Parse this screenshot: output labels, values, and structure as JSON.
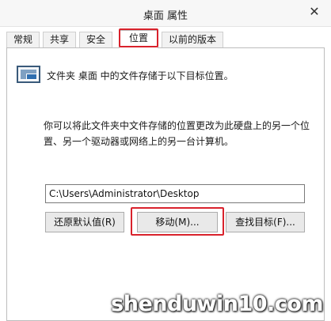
{
  "window": {
    "title": "桌面 属性",
    "close_glyph": "✕"
  },
  "tabs": [
    {
      "label": "常规",
      "active": false
    },
    {
      "label": "共享",
      "active": false
    },
    {
      "label": "安全",
      "active": false
    },
    {
      "label": "位置",
      "active": true
    },
    {
      "label": "以前的版本",
      "active": false
    }
  ],
  "panel": {
    "description": "文件夹 桌面 中的文件存储于以下目标位置。",
    "info": "你可以将此文件夹中文件存储的位置更改为此硬盘上的另一个位置、另一个驱动器或网络上的另一台计算机。",
    "path_value": "C:\\Users\\Administrator\\Desktop",
    "buttons": {
      "restore": "还原默认值(R)",
      "move": "移动(M)...",
      "find": "查找目标(F)..."
    }
  },
  "watermark": {
    "text": "shenduwin10.com"
  },
  "colors": {
    "highlight": "#d9222c",
    "folder_icon": "#2f6fb0"
  }
}
